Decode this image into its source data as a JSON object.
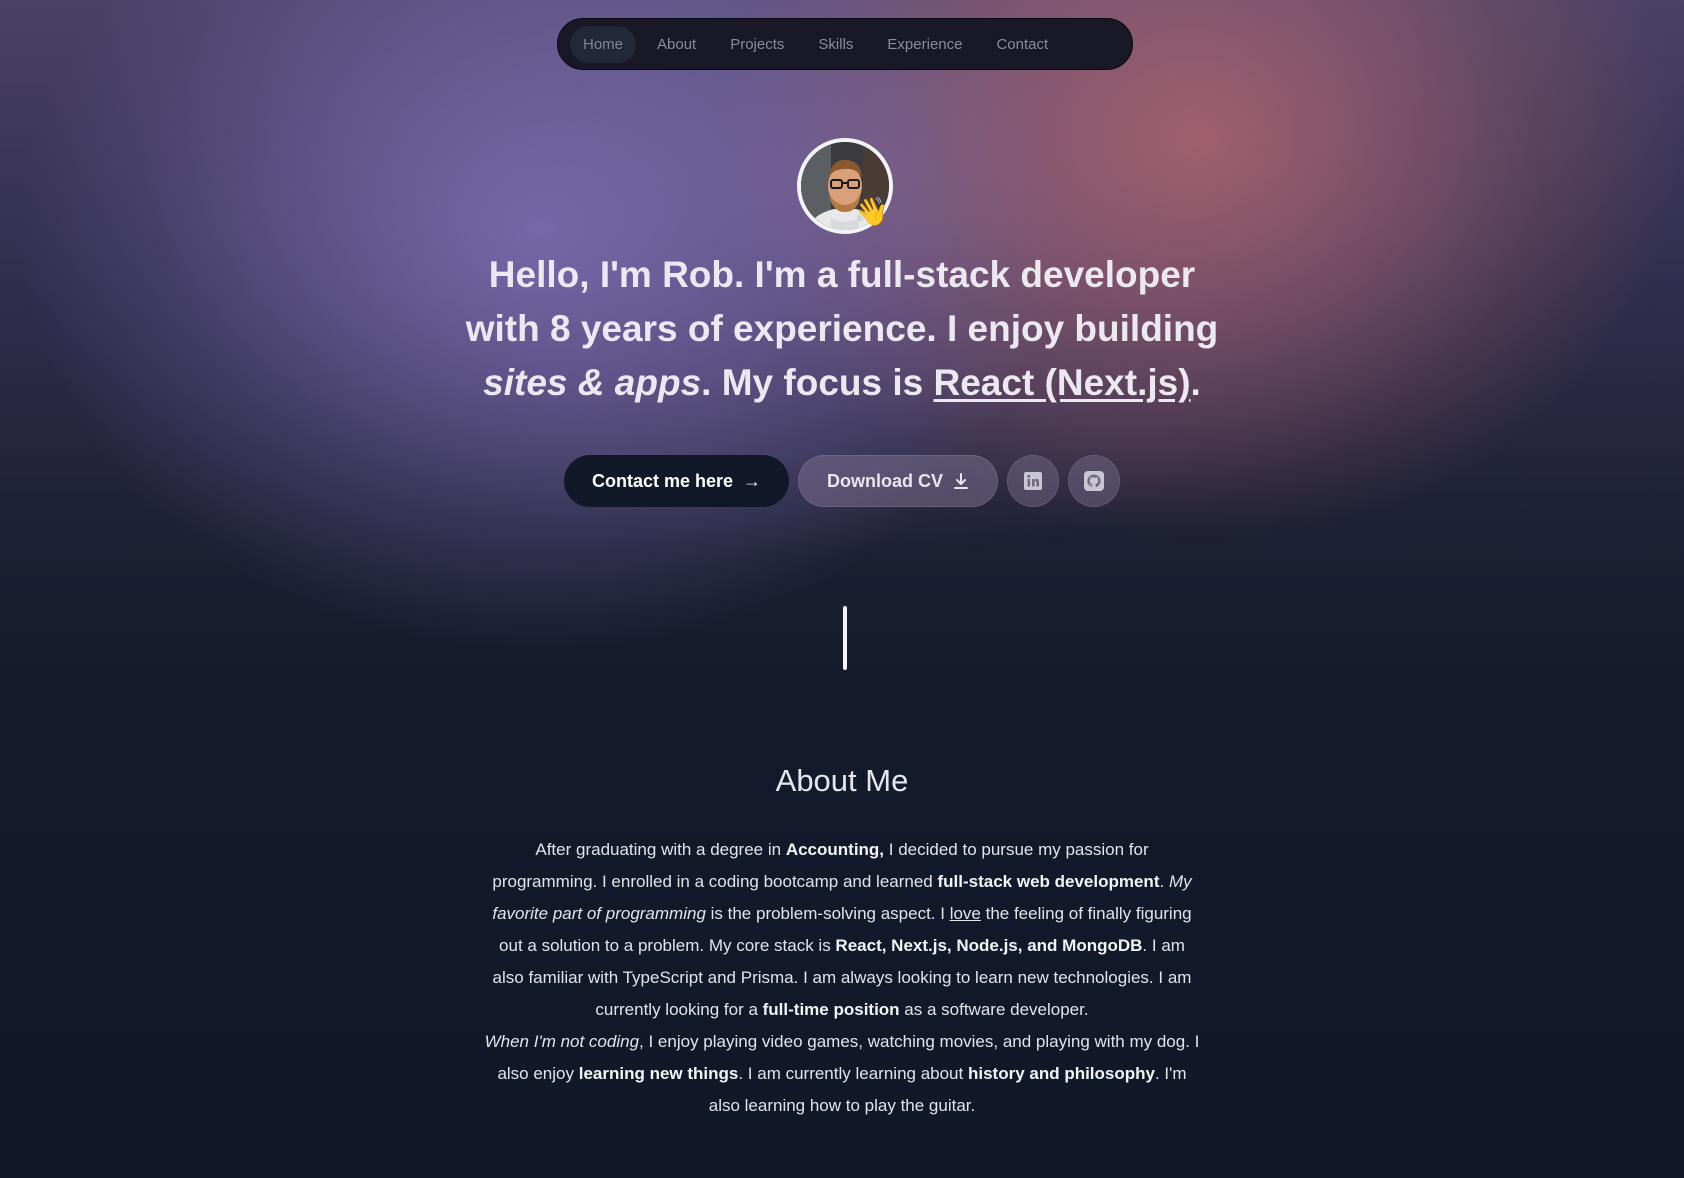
{
  "nav": {
    "items": [
      {
        "label": "Home",
        "active": true
      },
      {
        "label": "About",
        "active": false
      },
      {
        "label": "Projects",
        "active": false
      },
      {
        "label": "Skills",
        "active": false
      },
      {
        "label": "Experience",
        "active": false
      },
      {
        "label": "Contact",
        "active": false
      }
    ]
  },
  "hero": {
    "avatar_alt": "Rob",
    "wave_emoji": "👋",
    "headline": {
      "p1": "Hello, I'm Rob.",
      "p2": " I'm a ",
      "p3": "full-stack developer",
      "p4": " with ",
      "p5": "8 years",
      "p6": " of experience. I enjoy building ",
      "p7": "sites & apps",
      "p8": ". My focus is ",
      "p9": "React (Next.js)",
      "p10": "."
    },
    "buttons": {
      "contact_label": "Contact me here",
      "contact_arrow": "→",
      "download_label": "Download CV",
      "linkedin_icon": "linkedin-icon",
      "github_icon": "github-icon"
    }
  },
  "about": {
    "title": "About Me",
    "paragraph1": {
      "t1": "After graduating with a degree in ",
      "b1": "Accounting,",
      "t2": " I decided to pursue my passion for programming. I enrolled in a coding bootcamp and learned ",
      "b2": "full-stack web development",
      "t3": ". ",
      "i1": "My favorite part of programming",
      "t4": " is the problem-solving aspect. I ",
      "u1": "love",
      "t5": " the feeling of finally figuring out a solution to a problem. My core stack is ",
      "b3": "React, Next.js, Node.js, and MongoDB",
      "t6": ". I am also familiar with TypeScript and Prisma. I am always looking to learn new technologies. I am currently looking for a ",
      "b4": "full-time position",
      "t7": " as a software developer."
    },
    "paragraph2": {
      "i1": "When I'm not coding",
      "t1": ", I enjoy playing video games, watching movies, and playing with my dog. I also enjoy ",
      "b1": "learning new things",
      "t2": ". I am currently learning about ",
      "b2": "history and philosophy",
      "t3": ". I'm also learning how to play the guitar."
    }
  },
  "colors": {
    "background": "#111827",
    "nav_bg": "#181826",
    "primary_button": "#111827",
    "text": "#e5e7eb"
  }
}
